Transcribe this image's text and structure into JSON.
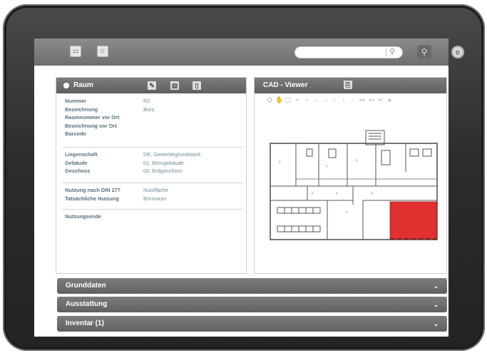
{
  "toolbar": {
    "org_icon": "org-chart-icon",
    "home_icon": "house-icon",
    "search": {
      "value": "",
      "placeholder": "",
      "icon": "search-icon"
    },
    "user_search_icon": "user-search-icon"
  },
  "raum": {
    "title": "Raum",
    "icons": [
      "edit-icon",
      "print-icon",
      "clipboard-icon"
    ],
    "group1": [
      {
        "label": "Nummer",
        "value": "R2"
      },
      {
        "label": "Bezeichnung",
        "value": "Büro"
      },
      {
        "label": "Raumnummer vor Ort",
        "value": ""
      },
      {
        "label": "Bezeichnung vor Ort",
        "value": ""
      },
      {
        "label": "Barcode",
        "value": ""
      }
    ],
    "group2": [
      {
        "label": "Liegenschaft",
        "value": "DE, Gewerbegrundstück"
      },
      {
        "label": "Gebäude",
        "value": "01, Bürogebäude"
      },
      {
        "label": "Geschoss",
        "value": "00, Erdgeschoss"
      }
    ],
    "group3": [
      {
        "label": "Nutzung nach DIN 277",
        "value": "Nutzfläche"
      },
      {
        "label": "Tatsächliche Nutzung",
        "value": "Büroraum"
      }
    ],
    "group4": [
      {
        "label": "Nutzungsende",
        "value": ""
      }
    ]
  },
  "cad": {
    "title": "CAD - Viewer",
    "tools": [
      "Q",
      "✋",
      "▢",
      "+",
      "−",
      "←",
      "→",
      "↑",
      "↓",
      "⋰",
      "↦",
      "↤",
      "↵",
      "▸"
    ],
    "highlight_color": "#e03030"
  },
  "accordion": [
    {
      "label": "Grunddaten"
    },
    {
      "label": "Ausstattung"
    },
    {
      "label": "Inventar (1)"
    }
  ]
}
